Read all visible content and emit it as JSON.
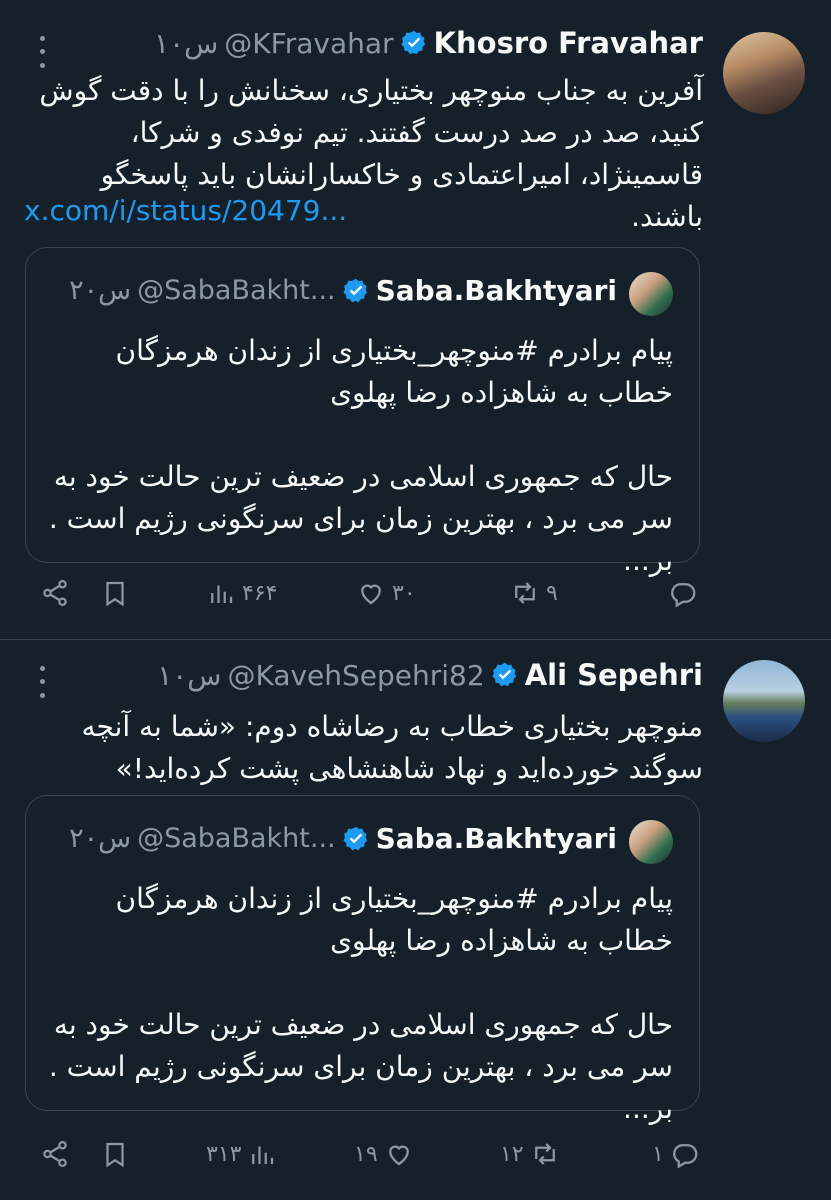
{
  "tweets": [
    {
      "author": "Khosro Fravahar",
      "handle": "@KFravahar",
      "time": "۱۰س",
      "text": "آفرین به جناب منوچهر بختیاری، سخنانش را با دقت گوش کنید، صد در صد درست گفتند. تیم نوفدی و شرکا، قاسمینژاد، امیراعتمادی و خاکسارانشان باید پاسخگو باشند.",
      "link": "x.com/i/status/20479...",
      "quote": {
        "author": "Saba.Bakhtyari",
        "handle": "@SabaBakht...",
        "time": "۲۰س",
        "paragraph1": "پیام برادرم #منوچهر_بختیاری از زندان هرمزگان خطاب به شاهزاده رضا پهلوی",
        "paragraph2": "حال که جمهوری اسلامی در ضعیف ترین حالت خود به سر می برد ، بهترین زمان برای سرنگونی رژیم است . بر..."
      },
      "stats": {
        "replies": "",
        "retweets": "۹",
        "likes": "۳۰",
        "views": "۴۶۴"
      }
    },
    {
      "author": "Ali Sepehri",
      "handle": "@KavehSepehri82",
      "time": "۱۰س",
      "text": "منوچهر بختیاری خطاب به رضاشاه دوم: «شما به آنچه سوگند خورده‌اید و نهاد شاهنشاهی پشت کرده‌اید!»",
      "quote": {
        "author": "Saba.Bakhtyari",
        "handle": "@SabaBakht...",
        "time": "۲۰س",
        "paragraph1": "پیام برادرم #منوچهر_بختیاری از زندان هرمزگان خطاب به شاهزاده رضا پهلوی",
        "paragraph2": "حال که جمهوری اسلامی در ضعیف ترین حالت خود به سر می برد ، بهترین زمان برای سرنگونی رژیم است . بر..."
      },
      "stats": {
        "replies": "۱",
        "retweets": "۱۲",
        "likes": "۱۹",
        "views": "۳۱۳"
      }
    }
  ],
  "colors": {
    "background": "#15202b",
    "text": "#f7f9f9",
    "muted": "#8b98a5",
    "link": "#1d9bf0",
    "verified": "#1d9bf0",
    "border": "#38444d"
  }
}
